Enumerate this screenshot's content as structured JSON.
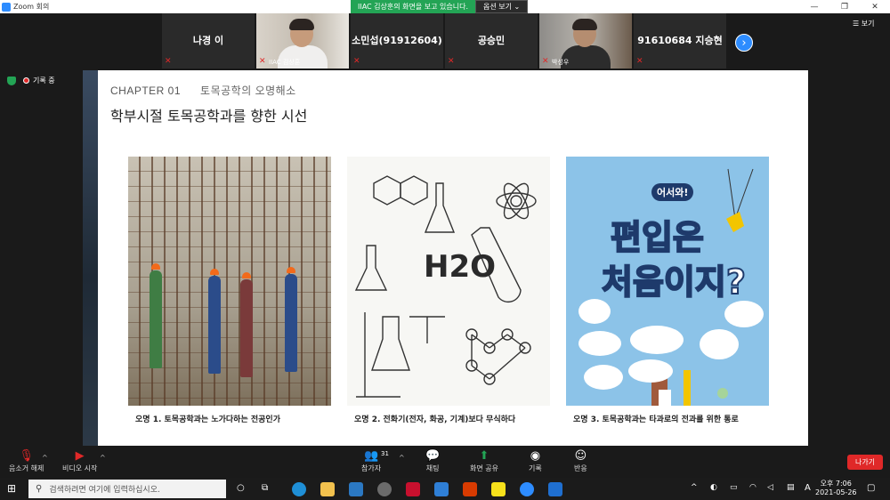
{
  "window": {
    "title": "Zoom 회의",
    "controls": [
      "—",
      "❐",
      "✕"
    ]
  },
  "share_banner": {
    "message": "IIAC 김상훈의 화면을 보고 있습니다.",
    "options_label": "옵션 보기 ⌄"
  },
  "participants": [
    {
      "name": "나경 이",
      "type": "name"
    },
    {
      "name": "IIAC 김상훈",
      "type": "video"
    },
    {
      "name": "소민섭(91912604)",
      "type": "name"
    },
    {
      "name": "공승민",
      "type": "name"
    },
    {
      "name": "박성우",
      "type": "video"
    },
    {
      "name": "91610684 지승현",
      "type": "name"
    }
  ],
  "view_button": "☰ 보기",
  "recording": {
    "label": "기록 중"
  },
  "slide": {
    "chapter": "CHAPTER 01",
    "chapter_subtitle": "토목공학의 오명해소",
    "title": "학부시절 토목공학과를 향한 시선",
    "cards": [
      {
        "caption": "오명 1. 토목공학과는 노가다하는 전공인가"
      },
      {
        "caption": "오명 2. 전화기(전자, 화공, 기계)보다 무식하다",
        "image_text": "H2O"
      },
      {
        "caption": "오명 3. 토목공학과는 타과로의 전과를 위한 통로",
        "image_badge": "어서와!",
        "image_line1": "편입은",
        "image_line2": "처음이지?"
      }
    ]
  },
  "toolbar": {
    "mute_label": "음소거 해제",
    "video_label": "비디오 시작",
    "participants_label": "참가자",
    "participants_count": "31",
    "chat_label": "채팅",
    "share_label": "화면 공유",
    "record_label": "기록",
    "reactions_label": "반응",
    "leave_label": "나가기"
  },
  "taskbar": {
    "search_placeholder": "검색하려면 여기에 입력하십시오.",
    "time": "오후 7:06",
    "date": "2021-05-26",
    "ime": "A"
  },
  "colors": {
    "zoom_blue": "#2d8cff",
    "share_green": "#23a455",
    "leave_red": "#e02828"
  }
}
